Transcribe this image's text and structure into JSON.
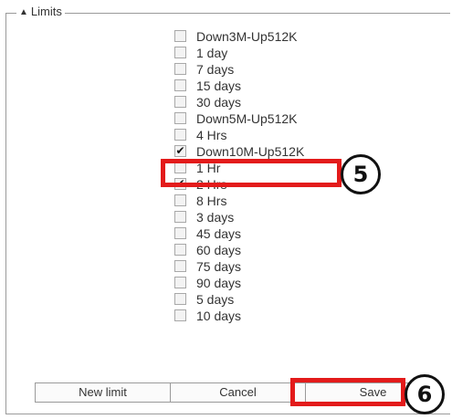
{
  "section": {
    "title": "Limits",
    "toggle_icon": "triangle-up-icon"
  },
  "limits": [
    {
      "label": "Down3M-Up512K",
      "checked": false
    },
    {
      "label": "1 day",
      "checked": false
    },
    {
      "label": "7 days",
      "checked": false
    },
    {
      "label": "15 days",
      "checked": false
    },
    {
      "label": "30 days",
      "checked": false
    },
    {
      "label": "Down5M-Up512K",
      "checked": false
    },
    {
      "label": "4 Hrs",
      "checked": false
    },
    {
      "label": "Down10M-Up512K",
      "checked": true
    },
    {
      "label": "1 Hr",
      "checked": false
    },
    {
      "label": "2 Hrs",
      "checked": true
    },
    {
      "label": "8 Hrs",
      "checked": false
    },
    {
      "label": "3 days",
      "checked": false
    },
    {
      "label": "45 days",
      "checked": false
    },
    {
      "label": "60 days",
      "checked": false
    },
    {
      "label": "75 days",
      "checked": false
    },
    {
      "label": "90 days",
      "checked": false
    },
    {
      "label": "5 days",
      "checked": false
    },
    {
      "label": "10 days",
      "checked": false
    }
  ],
  "buttons": {
    "new_limit": "New limit",
    "cancel": "Cancel",
    "save": "Save"
  },
  "annotations": {
    "step_checkbox": "5",
    "step_save": "6",
    "highlight_color": "#e31b1b"
  }
}
